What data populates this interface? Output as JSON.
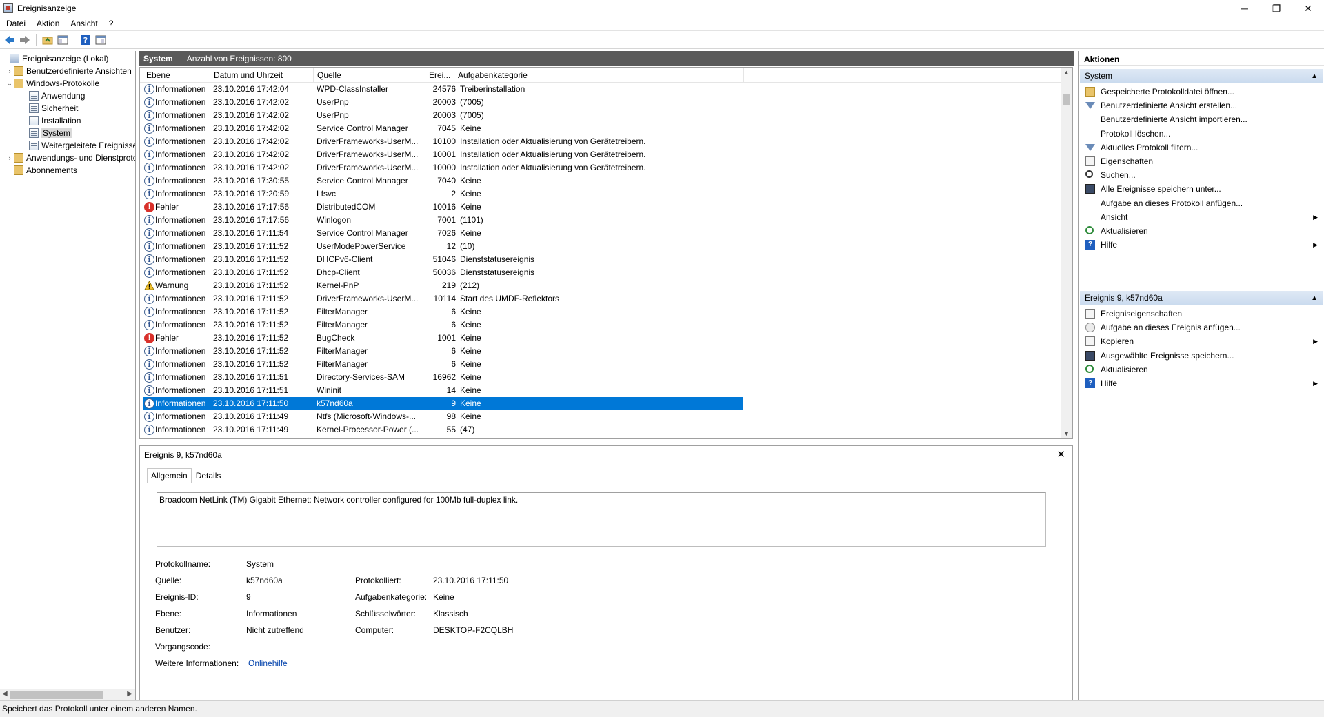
{
  "window": {
    "title": "Ereignisanzeige",
    "minimize": "─",
    "maximize": "❐",
    "close": "✕"
  },
  "menu": [
    "Datei",
    "Aktion",
    "Ansicht",
    "?"
  ],
  "toolbar_icons": [
    "back-arrow-icon",
    "forward-arrow-icon",
    "up-folder-icon",
    "show-hide-console-tree-icon",
    "help-icon",
    "show-hide-action-pane-icon"
  ],
  "tree": [
    {
      "label": "Ereignisanzeige (Lokal)",
      "icon": "root",
      "indent": 0,
      "exp": ""
    },
    {
      "label": "Benutzerdefinierte Ansichten",
      "icon": "folder",
      "indent": 1,
      "exp": "›"
    },
    {
      "label": "Windows-Protokolle",
      "icon": "folder",
      "indent": 1,
      "exp": "⌄"
    },
    {
      "label": "Anwendung",
      "icon": "log",
      "indent": 2,
      "exp": ""
    },
    {
      "label": "Sicherheit",
      "icon": "log",
      "indent": 2,
      "exp": ""
    },
    {
      "label": "Installation",
      "icon": "log",
      "indent": 2,
      "exp": ""
    },
    {
      "label": "System",
      "icon": "log",
      "indent": 2,
      "exp": "",
      "selected": true
    },
    {
      "label": "Weitergeleitete Ereignisse",
      "icon": "log",
      "indent": 2,
      "exp": ""
    },
    {
      "label": "Anwendungs- und Dienstprotokolle",
      "icon": "folder",
      "indent": 1,
      "exp": "›"
    },
    {
      "label": "Abonnements",
      "icon": "folder",
      "indent": 1,
      "exp": ""
    }
  ],
  "list_header": {
    "log_name": "System",
    "count_text": "Anzahl von Ereignissen: 800"
  },
  "columns": [
    "Ebene",
    "Datum und Uhrzeit",
    "Quelle",
    "Erei...",
    "Aufgabenkategorie"
  ],
  "events": [
    {
      "level": "Informationen",
      "type": "info",
      "date": "23.10.2016 17:42:04",
      "source": "WPD-ClassInstaller",
      "id": "24576",
      "category": "Treiberinstallation"
    },
    {
      "level": "Informationen",
      "type": "info",
      "date": "23.10.2016 17:42:02",
      "source": "UserPnp",
      "id": "20003",
      "category": "(7005)"
    },
    {
      "level": "Informationen",
      "type": "info",
      "date": "23.10.2016 17:42:02",
      "source": "UserPnp",
      "id": "20003",
      "category": "(7005)"
    },
    {
      "level": "Informationen",
      "type": "info",
      "date": "23.10.2016 17:42:02",
      "source": "Service Control Manager",
      "id": "7045",
      "category": "Keine"
    },
    {
      "level": "Informationen",
      "type": "info",
      "date": "23.10.2016 17:42:02",
      "source": "DriverFrameworks-UserM...",
      "id": "10100",
      "category": "Installation oder Aktualisierung von Gerätetreibern."
    },
    {
      "level": "Informationen",
      "type": "info",
      "date": "23.10.2016 17:42:02",
      "source": "DriverFrameworks-UserM...",
      "id": "10001",
      "category": "Installation oder Aktualisierung von Gerätetreibern."
    },
    {
      "level": "Informationen",
      "type": "info",
      "date": "23.10.2016 17:42:02",
      "source": "DriverFrameworks-UserM...",
      "id": "10000",
      "category": "Installation oder Aktualisierung von Gerätetreibern."
    },
    {
      "level": "Informationen",
      "type": "info",
      "date": "23.10.2016 17:30:55",
      "source": "Service Control Manager",
      "id": "7040",
      "category": "Keine"
    },
    {
      "level": "Informationen",
      "type": "info",
      "date": "23.10.2016 17:20:59",
      "source": "Lfsvc",
      "id": "2",
      "category": "Keine"
    },
    {
      "level": "Fehler",
      "type": "error",
      "date": "23.10.2016 17:17:56",
      "source": "DistributedCOM",
      "id": "10016",
      "category": "Keine"
    },
    {
      "level": "Informationen",
      "type": "info",
      "date": "23.10.2016 17:17:56",
      "source": "Winlogon",
      "id": "7001",
      "category": "(1101)"
    },
    {
      "level": "Informationen",
      "type": "info",
      "date": "23.10.2016 17:11:54",
      "source": "Service Control Manager",
      "id": "7026",
      "category": "Keine"
    },
    {
      "level": "Informationen",
      "type": "info",
      "date": "23.10.2016 17:11:52",
      "source": "UserModePowerService",
      "id": "12",
      "category": "(10)"
    },
    {
      "level": "Informationen",
      "type": "info",
      "date": "23.10.2016 17:11:52",
      "source": "DHCPv6-Client",
      "id": "51046",
      "category": "Dienststatusereignis"
    },
    {
      "level": "Informationen",
      "type": "info",
      "date": "23.10.2016 17:11:52",
      "source": "Dhcp-Client",
      "id": "50036",
      "category": "Dienststatusereignis"
    },
    {
      "level": "Warnung",
      "type": "warning",
      "date": "23.10.2016 17:11:52",
      "source": "Kernel-PnP",
      "id": "219",
      "category": "(212)"
    },
    {
      "level": "Informationen",
      "type": "info",
      "date": "23.10.2016 17:11:52",
      "source": "DriverFrameworks-UserM...",
      "id": "10114",
      "category": "Start des UMDF-Reflektors"
    },
    {
      "level": "Informationen",
      "type": "info",
      "date": "23.10.2016 17:11:52",
      "source": "FilterManager",
      "id": "6",
      "category": "Keine"
    },
    {
      "level": "Informationen",
      "type": "info",
      "date": "23.10.2016 17:11:52",
      "source": "FilterManager",
      "id": "6",
      "category": "Keine"
    },
    {
      "level": "Fehler",
      "type": "error",
      "date": "23.10.2016 17:11:52",
      "source": "BugCheck",
      "id": "1001",
      "category": "Keine"
    },
    {
      "level": "Informationen",
      "type": "info",
      "date": "23.10.2016 17:11:52",
      "source": "FilterManager",
      "id": "6",
      "category": "Keine"
    },
    {
      "level": "Informationen",
      "type": "info",
      "date": "23.10.2016 17:11:52",
      "source": "FilterManager",
      "id": "6",
      "category": "Keine"
    },
    {
      "level": "Informationen",
      "type": "info",
      "date": "23.10.2016 17:11:51",
      "source": "Directory-Services-SAM",
      "id": "16962",
      "category": "Keine"
    },
    {
      "level": "Informationen",
      "type": "info",
      "date": "23.10.2016 17:11:51",
      "source": "Wininit",
      "id": "14",
      "category": "Keine"
    },
    {
      "level": "Informationen",
      "type": "info",
      "date": "23.10.2016 17:11:50",
      "source": "k57nd60a",
      "id": "9",
      "category": "Keine",
      "selected": true
    },
    {
      "level": "Informationen",
      "type": "info",
      "date": "23.10.2016 17:11:49",
      "source": "Ntfs (Microsoft-Windows-...",
      "id": "98",
      "category": "Keine"
    },
    {
      "level": "Informationen",
      "type": "info",
      "date": "23.10.2016 17:11:49",
      "source": "Kernel-Processor-Power (...",
      "id": "55",
      "category": "(47)"
    }
  ],
  "detail": {
    "title": "Ereignis 9, k57nd60a",
    "tabs": [
      "Allgemein",
      "Details"
    ],
    "message": "Broadcom NetLink (TM) Gigabit Ethernet: Network controller configured for 100Mb full-duplex link.",
    "labels": {
      "protokollname": "Protokollname:",
      "quelle": "Quelle:",
      "ereignis_id": "Ereignis-ID:",
      "ebene": "Ebene:",
      "benutzer": "Benutzer:",
      "vorgangscode": "Vorgangscode:",
      "weitere": "Weitere Informationen:",
      "protokolliert": "Protokolliert:",
      "aufgabenkategorie": "Aufgabenkategorie:",
      "schluesselwoerter": "Schlüsselwörter:",
      "computer": "Computer:"
    },
    "values": {
      "protokollname": "System",
      "quelle": "k57nd60a",
      "ereignis_id": "9",
      "ebene": "Informationen",
      "benutzer": "Nicht zutreffend",
      "vorgangscode": "",
      "weitere": "Onlinehilfe",
      "protokolliert": "23.10.2016 17:11:50",
      "aufgabenkategorie": "Keine",
      "schluesselwoerter": "Klassisch",
      "computer": "DESKTOP-F2CQLBH"
    }
  },
  "actions": {
    "title": "Aktionen",
    "section1": "System",
    "items1": [
      {
        "label": "Gespeicherte Protokolldatei öffnen...",
        "icon": "folder"
      },
      {
        "label": "Benutzerdefinierte Ansicht erstellen...",
        "icon": "filter"
      },
      {
        "label": "Benutzerdefinierte Ansicht importieren...",
        "icon": ""
      },
      {
        "label": "Protokoll löschen...",
        "icon": ""
      },
      {
        "label": "Aktuelles Protokoll filtern...",
        "icon": "filter"
      },
      {
        "label": "Eigenschaften",
        "icon": "props"
      },
      {
        "label": "Suchen...",
        "icon": "find"
      },
      {
        "label": "Alle Ereignisse speichern unter...",
        "icon": "save"
      },
      {
        "label": "Aufgabe an dieses Protokoll anfügen...",
        "icon": ""
      },
      {
        "label": "Ansicht",
        "icon": "",
        "sub": true
      },
      {
        "label": "Aktualisieren",
        "icon": "refresh"
      },
      {
        "label": "Hilfe",
        "icon": "help",
        "sub": true
      }
    ],
    "section2": "Ereignis 9, k57nd60a",
    "items2": [
      {
        "label": "Ereigniseigenschaften",
        "icon": "props"
      },
      {
        "label": "Aufgabe an dieses Ereignis anfügen...",
        "icon": "task"
      },
      {
        "label": "Kopieren",
        "icon": "props",
        "sub": true
      },
      {
        "label": "Ausgewählte Ereignisse speichern...",
        "icon": "save"
      },
      {
        "label": "Aktualisieren",
        "icon": "refresh"
      },
      {
        "label": "Hilfe",
        "icon": "help",
        "sub": true
      }
    ]
  },
  "status": "Speichert das Protokoll unter einem anderen Namen."
}
